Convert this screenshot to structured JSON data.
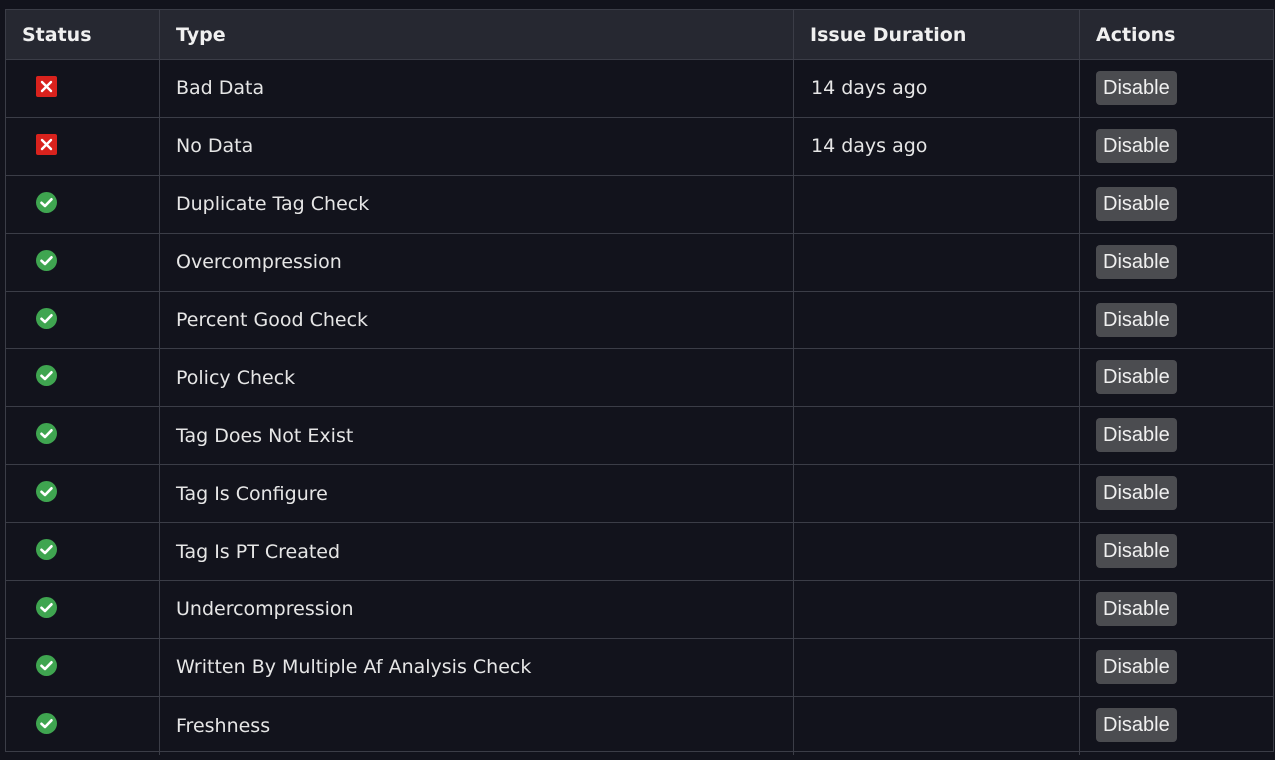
{
  "table": {
    "headers": {
      "status": "Status",
      "type": "Type",
      "duration": "Issue Duration",
      "actions": "Actions"
    },
    "rows": [
      {
        "status": "fail",
        "type": "Bad Data",
        "duration": "14 days ago",
        "action": "Disable"
      },
      {
        "status": "fail",
        "type": "No Data",
        "duration": "14 days ago",
        "action": "Disable"
      },
      {
        "status": "ok",
        "type": "Duplicate Tag Check",
        "duration": "",
        "action": "Disable"
      },
      {
        "status": "ok",
        "type": "Overcompression",
        "duration": "",
        "action": "Disable"
      },
      {
        "status": "ok",
        "type": "Percent Good Check",
        "duration": "",
        "action": "Disable"
      },
      {
        "status": "ok",
        "type": "Policy Check",
        "duration": "",
        "action": "Disable"
      },
      {
        "status": "ok",
        "type": "Tag Does Not Exist",
        "duration": "",
        "action": "Disable"
      },
      {
        "status": "ok",
        "type": "Tag Is Configure",
        "duration": "",
        "action": "Disable"
      },
      {
        "status": "ok",
        "type": "Tag Is PT Created",
        "duration": "",
        "action": "Disable"
      },
      {
        "status": "ok",
        "type": "Undercompression",
        "duration": "",
        "action": "Disable"
      },
      {
        "status": "ok",
        "type": "Written By Multiple Af Analysis Check",
        "duration": "",
        "action": "Disable"
      },
      {
        "status": "ok",
        "type": "Freshness",
        "duration": "",
        "action": "Disable"
      }
    ]
  },
  "icons": {
    "fail": "close-x-icon",
    "ok": "check-circle-icon"
  },
  "colors": {
    "background": "#12131c",
    "header_background": "#262831",
    "border": "#3b3d47",
    "fail": "#d9221d",
    "ok": "#3fa550",
    "button": "#4b4c50"
  }
}
